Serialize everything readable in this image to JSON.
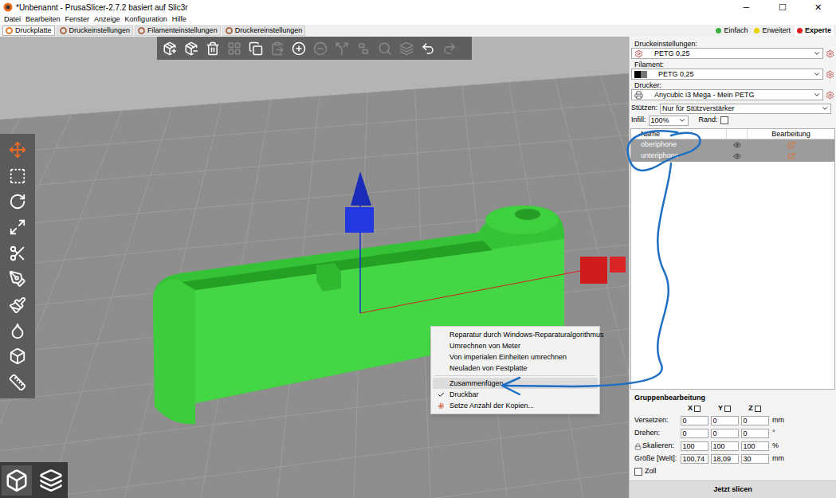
{
  "window": {
    "title": "*Unbenannt - PrusaSlicer-2.7.2 basiert auf Slic3r",
    "controls": [
      "─",
      "☐",
      "✕"
    ]
  },
  "menu": [
    "Datei",
    "Bearbeiten",
    "Fenster",
    "Anzeige",
    "Konfiguration",
    "Hilfe"
  ],
  "tabs": [
    {
      "label": "Druckplatte",
      "selected": true
    },
    {
      "label": "Druckeinstellungen",
      "selected": false
    },
    {
      "label": "Filamenteinstellungen",
      "selected": false
    },
    {
      "label": "Druckereinstellungen",
      "selected": false
    }
  ],
  "modes": [
    {
      "label": "Einfach",
      "selected": false,
      "color": "#3cb043"
    },
    {
      "label": "Erweitert",
      "selected": false,
      "color": "#e8d400"
    },
    {
      "label": "Experte",
      "selected": true,
      "color": "#e02020"
    }
  ],
  "top_toolbar": [
    {
      "enabled": true
    },
    {
      "enabled": true
    },
    {
      "enabled": true
    },
    {
      "enabled": false
    },
    {
      "enabled": true
    },
    {
      "enabled": false
    },
    {
      "enabled": true
    },
    {
      "enabled": false
    },
    {
      "enabled": false
    },
    {
      "enabled": false
    },
    {
      "enabled": false
    },
    {
      "enabled": false
    },
    {
      "enabled": true
    },
    {
      "enabled": false
    }
  ],
  "left_toolbar": [
    {
      "selected": true
    },
    {
      "selected": false
    },
    {
      "selected": false
    },
    {
      "selected": false
    },
    {
      "selected": false
    },
    {
      "selected": false
    },
    {
      "selected": false
    },
    {
      "selected": false
    },
    {
      "selected": false
    },
    {
      "selected": false
    }
  ],
  "view_buttons": [
    {
      "selected": true
    },
    {
      "selected": false
    }
  ],
  "presets": [
    {
      "label": "Druckeinstellungen:",
      "value": "PETG 0,25",
      "kind": "print"
    },
    {
      "label": "Filament:",
      "value": "PETG 0,25",
      "kind": "filament"
    },
    {
      "label": "Drucker:",
      "value": "Anycubic i3 Mega - Mein PETG",
      "kind": "printer"
    }
  ],
  "supports": {
    "label": "Stützen:",
    "value": "Nur für Stützverstärker"
  },
  "infill": {
    "label": "Infill:",
    "value": "100%"
  },
  "brim": {
    "label": "Rand:",
    "checked": false
  },
  "object_list": {
    "columns": [
      "Name",
      "Bearbeitung"
    ],
    "rows": [
      {
        "name": "oberiphone",
        "selected": true,
        "visible": true
      },
      {
        "name": "unteriphone",
        "selected": true,
        "visible": true
      }
    ]
  },
  "group_edit": {
    "title": "Gruppenbearbeitung",
    "axes": [
      "X",
      "Y",
      "Z"
    ],
    "rows": [
      {
        "label": "Versetzen:",
        "values": [
          "0",
          "0",
          "0"
        ],
        "unit": "mm",
        "locked": false
      },
      {
        "label": "Drehen:",
        "values": [
          "0",
          "0",
          "0"
        ],
        "unit": "°",
        "locked": false
      },
      {
        "label": "Skalieren:",
        "values": [
          "100",
          "100",
          "100"
        ],
        "unit": "%",
        "locked": true
      },
      {
        "label": "Größe [Welt]:",
        "values": [
          "100,74",
          "18,09",
          "30"
        ],
        "unit": "mm",
        "locked": false
      }
    ],
    "inches": {
      "label": "Zoll",
      "checked": false
    }
  },
  "slice_button": "Jetzt slicen",
  "context_menu": [
    {
      "label": "Reparatur durch Windows-Reparaturalgorithmus",
      "kind": "plain",
      "highlighted": false,
      "checked": false
    },
    {
      "label": "Umrechnen von Meter",
      "kind": "plain",
      "highlighted": false,
      "checked": false
    },
    {
      "label": "Von imperialen Einheiten umrechnen",
      "kind": "plain",
      "highlighted": false,
      "checked": false
    },
    {
      "label": "Neuladen von Festplatte",
      "kind": "plain",
      "highlighted": false,
      "checked": false
    },
    {
      "label": "",
      "kind": "separator",
      "highlighted": false,
      "checked": false
    },
    {
      "label": "Zusammenfügen",
      "kind": "plain",
      "highlighted": true,
      "checked": false
    },
    {
      "label": "Druckbar",
      "kind": "check",
      "highlighted": false,
      "checked": true
    },
    {
      "label": "Setze Anzahl der Kopien...",
      "kind": "icon",
      "highlighted": false,
      "checked": false
    }
  ]
}
